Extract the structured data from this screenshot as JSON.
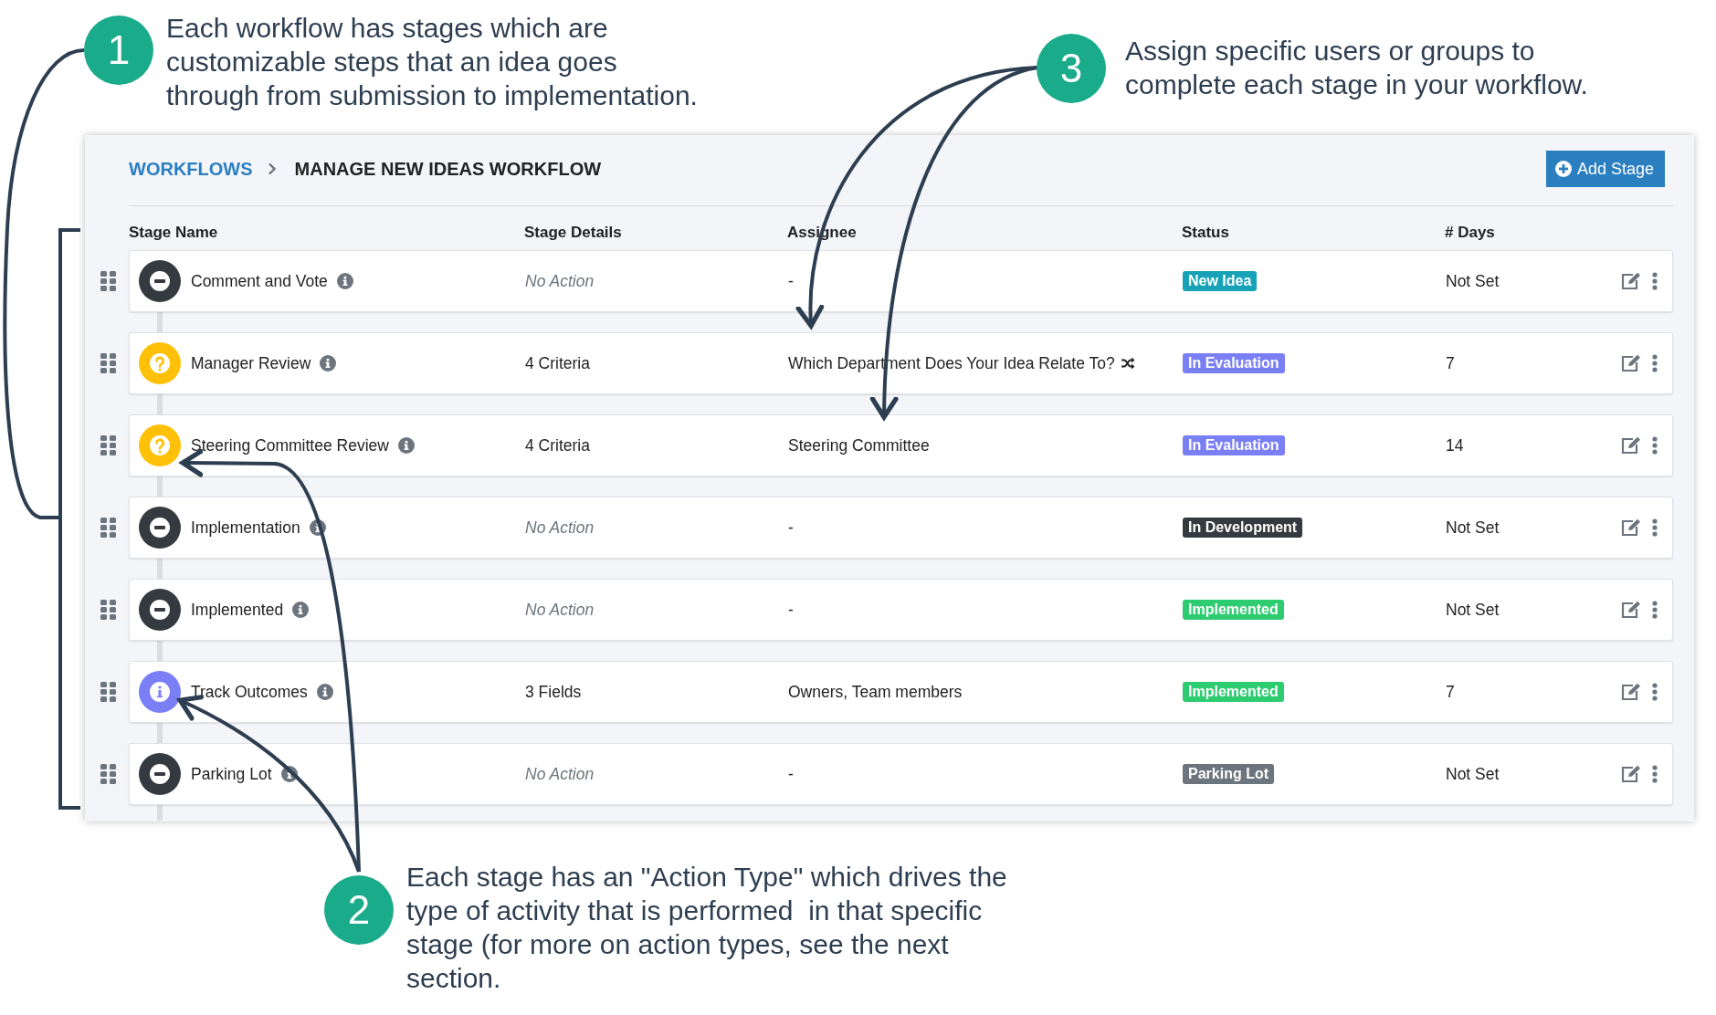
{
  "annotations": [
    {
      "number": "1",
      "lines": [
        "Each workflow has stages which are",
        "customizable steps that an idea goes",
        "through from submission to implementation."
      ]
    },
    {
      "number": "3",
      "lines": [
        "Assign specific users or groups to",
        "complete each stage in your workflow."
      ]
    },
    {
      "number": "2",
      "lines": [
        "Each stage has an \"Action Type\" which drives the",
        "type of activity that is performed  in that specific",
        "stage (for more on action types, see the next",
        "section."
      ]
    }
  ],
  "breadcrumb": {
    "parent": "WORKFLOWS",
    "current": "MANAGE NEW IDEAS WORKFLOW"
  },
  "add_button": "Add Stage",
  "columns": [
    "Stage Name",
    "Stage Details",
    "Assignee",
    "Status",
    "# Days"
  ],
  "stages": [
    {
      "kind": "no_action",
      "name": "Comment and Vote",
      "details": "No Action",
      "assignee": "-",
      "shuffle": false,
      "status": {
        "label": "New Idea",
        "color": "#17a2b8"
      },
      "days": "Not Set"
    },
    {
      "kind": "question",
      "name": "Manager Review",
      "details": "4 Criteria",
      "assignee": "Which Department Does Your Idea Relate To?",
      "shuffle": true,
      "status": {
        "label": "In Evaluation",
        "color": "#7b7ff5"
      },
      "days": "7"
    },
    {
      "kind": "question",
      "name": "Steering Committee Review",
      "details": "4 Criteria",
      "assignee": "Steering Committee",
      "shuffle": false,
      "status": {
        "label": "In Evaluation",
        "color": "#7b7ff5"
      },
      "days": "14"
    },
    {
      "kind": "no_action",
      "name": "Implementation",
      "details": "No Action",
      "assignee": "-",
      "shuffle": false,
      "status": {
        "label": "In Development",
        "color": "#343a40"
      },
      "days": "Not Set"
    },
    {
      "kind": "no_action",
      "name": "Implemented",
      "details": "No Action",
      "assignee": "-",
      "shuffle": false,
      "status": {
        "label": "Implemented",
        "color": "#2ecc71"
      },
      "days": "Not Set"
    },
    {
      "kind": "info",
      "name": "Track Outcomes",
      "details": "3 Fields",
      "assignee": "Owners, Team members",
      "shuffle": false,
      "status": {
        "label": "Implemented",
        "color": "#2ecc71"
      },
      "days": "7"
    },
    {
      "kind": "no_action",
      "name": "Parking Lot",
      "details": "No Action",
      "assignee": "-",
      "shuffle": false,
      "status": {
        "label": "Parking Lot",
        "color": "#6c757d"
      },
      "days": "Not Set"
    }
  ]
}
